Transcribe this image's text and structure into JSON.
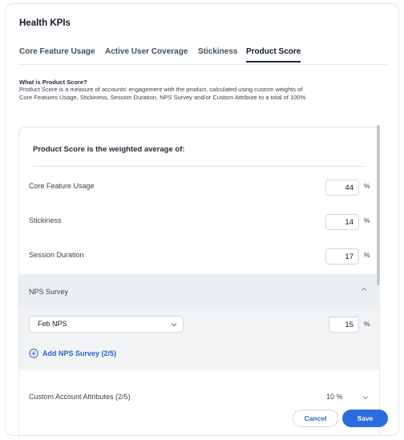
{
  "modal": {
    "title": "Health KPIs",
    "tabs": [
      {
        "label": "Core Feature Usage",
        "active": false
      },
      {
        "label": "Active User Coverage",
        "active": false
      },
      {
        "label": "Stickiness",
        "active": false
      },
      {
        "label": "Product Score",
        "active": true
      }
    ],
    "description": {
      "title": "What is Product Score?",
      "body": "Product Score is a measure of accounts' engagement with the product, calculated using custom weights of Core Features Usage, Stickiness, Session Duration, NPS Survey and/or Custom Attribute to a total of 100%"
    },
    "panel": {
      "heading": "Product Score is the weighted average of:",
      "rows": [
        {
          "label": "Core Feature Usage",
          "value": "44",
          "unit": "%"
        },
        {
          "label": "Stickiness",
          "value": "14",
          "unit": "%"
        },
        {
          "label": "Session Duration",
          "value": "17",
          "unit": "%"
        }
      ],
      "nps": {
        "title": "NPS Survey",
        "selected_survey": "Feb NPS",
        "value": "15",
        "unit": "%",
        "add_label": "Add NPS Survey (2/5)"
      },
      "custom": {
        "label": "Custom Account Attributes (2/5)",
        "value": "10 %"
      }
    },
    "buttons": {
      "cancel": "Cancel",
      "save": "Save"
    },
    "colors": {
      "accent": "#2d6cdf",
      "link": "#2a63d4"
    }
  }
}
